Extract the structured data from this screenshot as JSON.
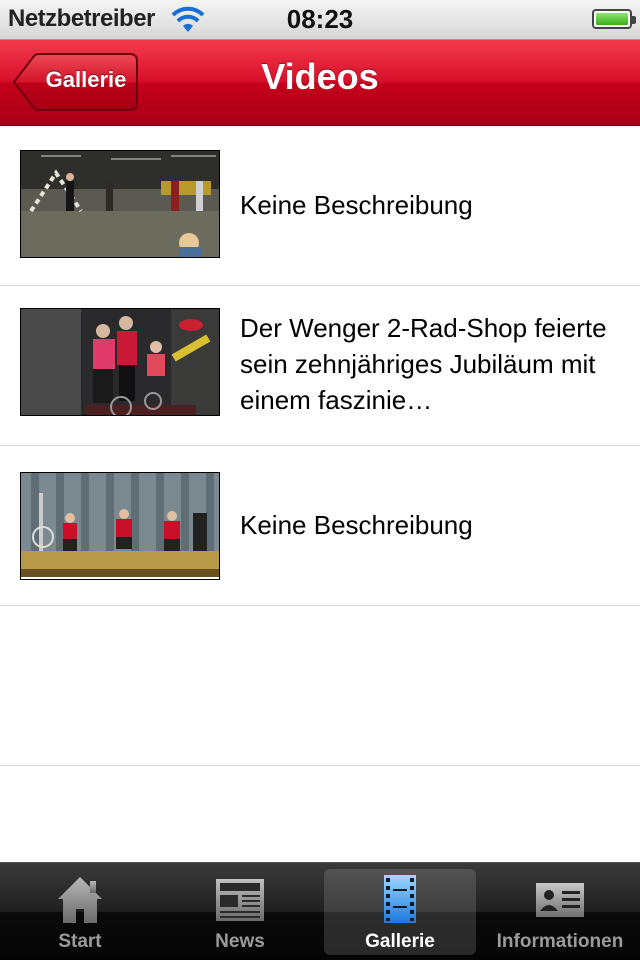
{
  "status_bar": {
    "carrier": "Netzbetreiber",
    "time": "08:23",
    "battery_color": "#3aad1b"
  },
  "nav": {
    "title": "Videos",
    "back_label": "Gallerie",
    "bar_color": "#d9102a"
  },
  "videos": [
    {
      "description": "Keine Beschreibung",
      "thumb_scene": "gym-juggling"
    },
    {
      "description": "Der Wenger 2-Rad-Shop feierte sein zehnjähriges Jubiläum mit einem faszinie…",
      "thumb_scene": "unicycle-group"
    },
    {
      "description": "Keine Beschreibung",
      "thumb_scene": "stage-dancers"
    }
  ],
  "tabs": [
    {
      "label": "Start",
      "icon": "house-icon",
      "active": false
    },
    {
      "label": "News",
      "icon": "newspaper-icon",
      "active": false
    },
    {
      "label": "Gallerie",
      "icon": "film-icon",
      "active": true
    },
    {
      "label": "Informationen",
      "icon": "contact-card-icon",
      "active": false
    }
  ]
}
